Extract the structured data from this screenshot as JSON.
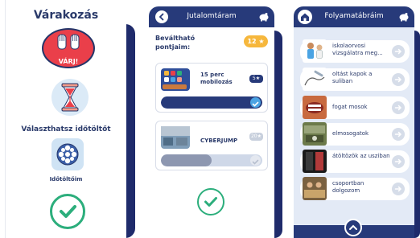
{
  "panel1": {
    "title": "Várakozás",
    "wait_button_label": "VÁRJ!",
    "choose_heading": "Választhatsz időtöltőt",
    "pastime_label": "Időtöltőim",
    "icons": [
      "raised-hands-icon",
      "hourglass-icon",
      "film-reel-icon",
      "check-icon"
    ]
  },
  "panel2": {
    "title": "Jutalomtáram",
    "points_label": "Beváltható pontjaim:",
    "points_value": "12",
    "rewards": [
      {
        "name": "15 perc mobilozás",
        "cost": "5",
        "progress": 1.0,
        "complete": true
      },
      {
        "name": "CYBERJUMP",
        "cost": "20",
        "progress": 0.5,
        "complete": false
      }
    ],
    "colors": {
      "accent": "#273a7a",
      "badge": "#f6b73c",
      "success": "#2cae7c"
    }
  },
  "panel3": {
    "title": "Folyamatábráim",
    "steps": [
      {
        "label": "iskolaorvosi vizsgálatra meg..."
      },
      {
        "label": "oltást kapok a suliban"
      },
      {
        "label": "fogat mosok"
      },
      {
        "label": "elmosogatok"
      },
      {
        "label": "átöltözök az usziban"
      },
      {
        "label": "csoportban dolgozom"
      }
    ]
  }
}
